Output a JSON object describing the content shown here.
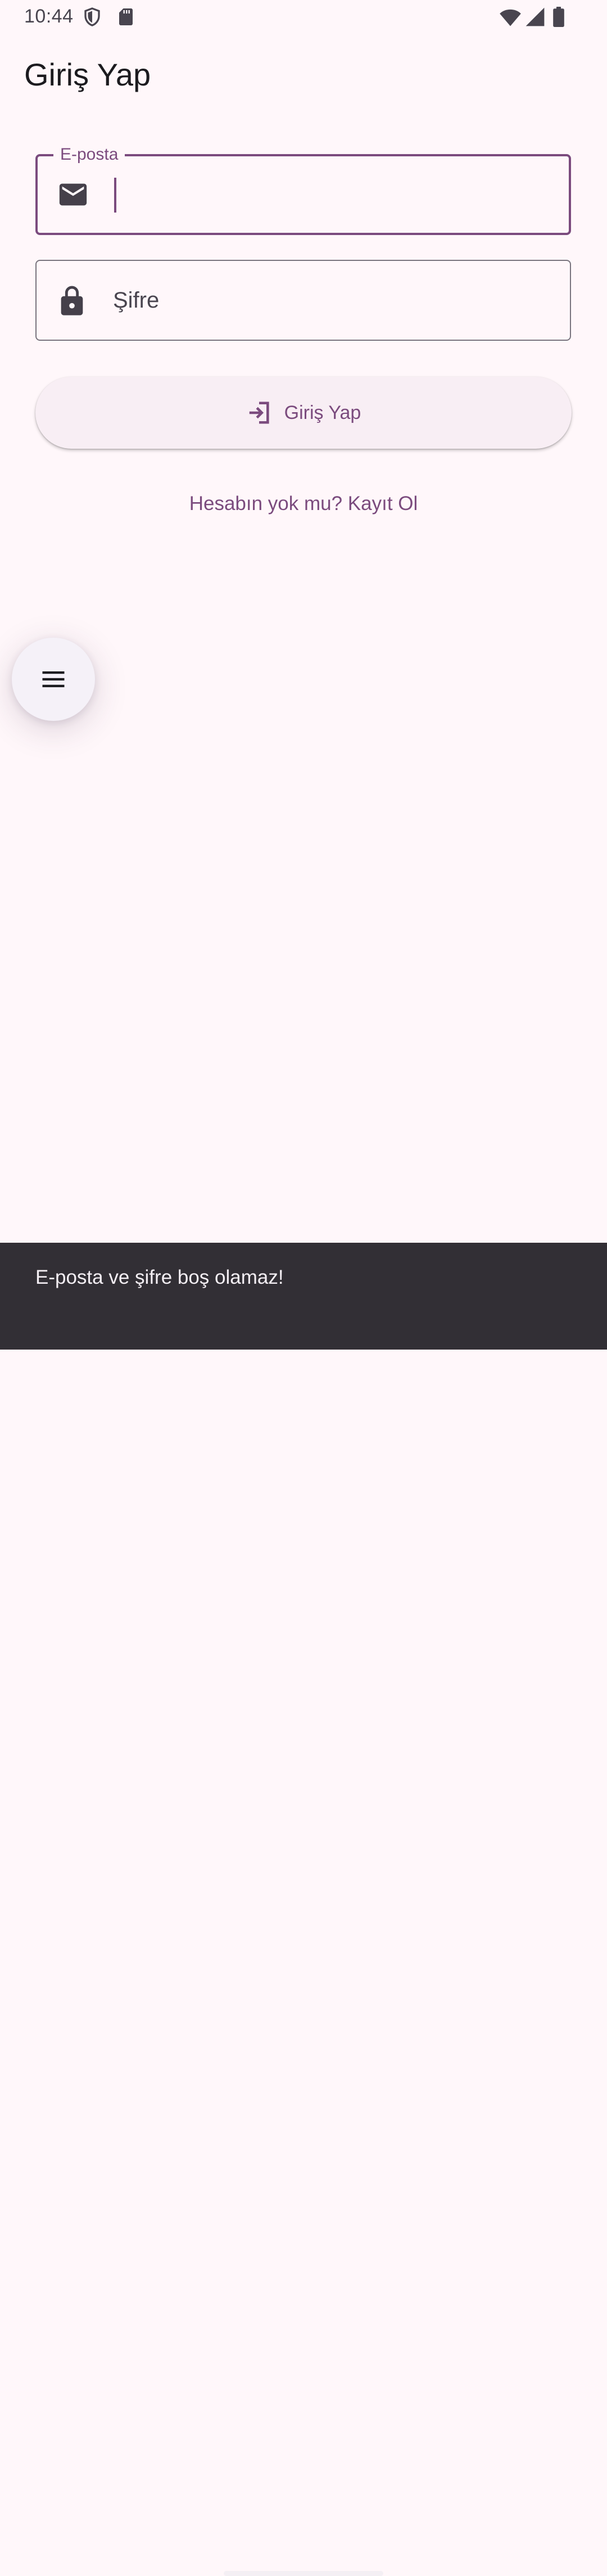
{
  "status_bar": {
    "time": "10:44",
    "left_icons": [
      "shield-icon",
      "sd-card-icon"
    ],
    "right_icons": [
      "wifi-icon",
      "signal-icon",
      "battery-icon"
    ]
  },
  "app_bar": {
    "title": "Giriş Yap"
  },
  "form": {
    "email": {
      "label": "E-posta",
      "value": "",
      "icon": "mail-icon"
    },
    "password": {
      "placeholder": "Şifre",
      "value": "",
      "icon": "lock-icon"
    },
    "login_button": {
      "label": "Giriş Yap",
      "icon": "login-icon"
    },
    "register_link": "Hesabın yok mu? Kayıt Ol"
  },
  "fab": {
    "icon": "menu-icon"
  },
  "snackbar": {
    "message": "E-posta ve şifre boş olamaz!"
  },
  "colors": {
    "background": "#FFF7FA",
    "primary": "#7B4B7E",
    "snackbar": "#322F35"
  }
}
